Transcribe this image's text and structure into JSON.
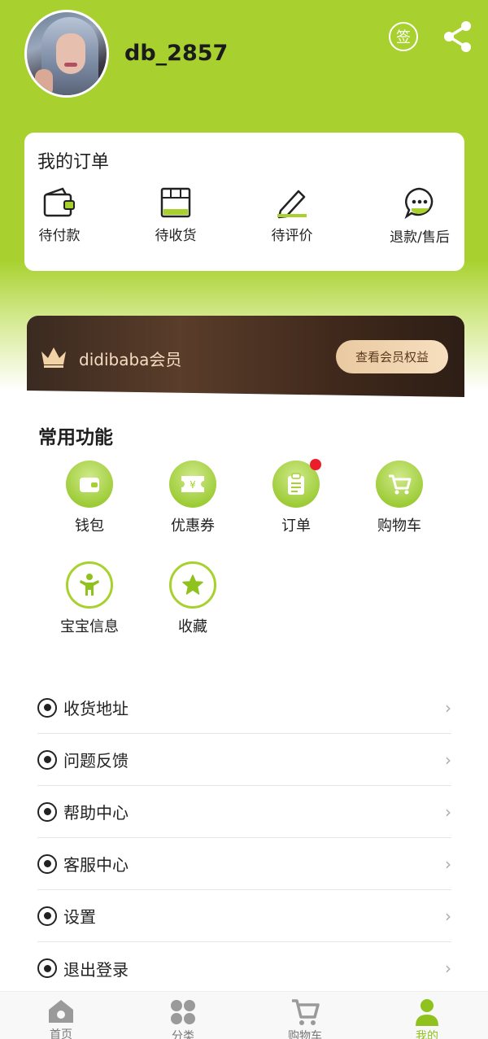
{
  "header": {
    "username": "db_2857",
    "sign_label": "签",
    "avatar_icon": "user-avatar",
    "share_icon": "share-icon"
  },
  "orders": {
    "title": "我的订单",
    "items": [
      {
        "label": "待付款",
        "icon": "wallet-icon"
      },
      {
        "label": "待收货",
        "icon": "box-icon"
      },
      {
        "label": "待评价",
        "icon": "pencil-icon"
      },
      {
        "label": "退款/售后",
        "icon": "chat-icon"
      }
    ]
  },
  "vip": {
    "name": "didibaba会员",
    "button": "查看会员权益",
    "crown_icon": "crown-icon"
  },
  "functions": {
    "title": "常用功能",
    "items": [
      {
        "label": "钱包",
        "icon": "wallet-icon"
      },
      {
        "label": "优惠券",
        "icon": "coupon-icon"
      },
      {
        "label": "订单",
        "icon": "clipboard-icon",
        "badge": true
      },
      {
        "label": "购物车",
        "icon": "cart-icon"
      },
      {
        "label": "宝宝信息",
        "icon": "baby-icon"
      },
      {
        "label": "收藏",
        "icon": "star-icon"
      }
    ]
  },
  "menu": {
    "items": [
      {
        "label": "收货地址"
      },
      {
        "label": "问题反馈"
      },
      {
        "label": "帮助中心"
      },
      {
        "label": "客服中心"
      },
      {
        "label": "设置"
      },
      {
        "label": "退出登录"
      }
    ]
  },
  "nav": {
    "items": [
      {
        "label": "首页",
        "icon": "home-icon"
      },
      {
        "label": "分类",
        "icon": "grid-icon"
      },
      {
        "label": "购物车",
        "icon": "cart-icon"
      },
      {
        "label": "我的",
        "icon": "user-icon",
        "active": true
      }
    ]
  },
  "colors": {
    "brand_green": "#a8d12f",
    "vip_brown": "#3a2a20",
    "vip_gold": "#e9c9a0",
    "badge_red": "#ec1c2b"
  }
}
